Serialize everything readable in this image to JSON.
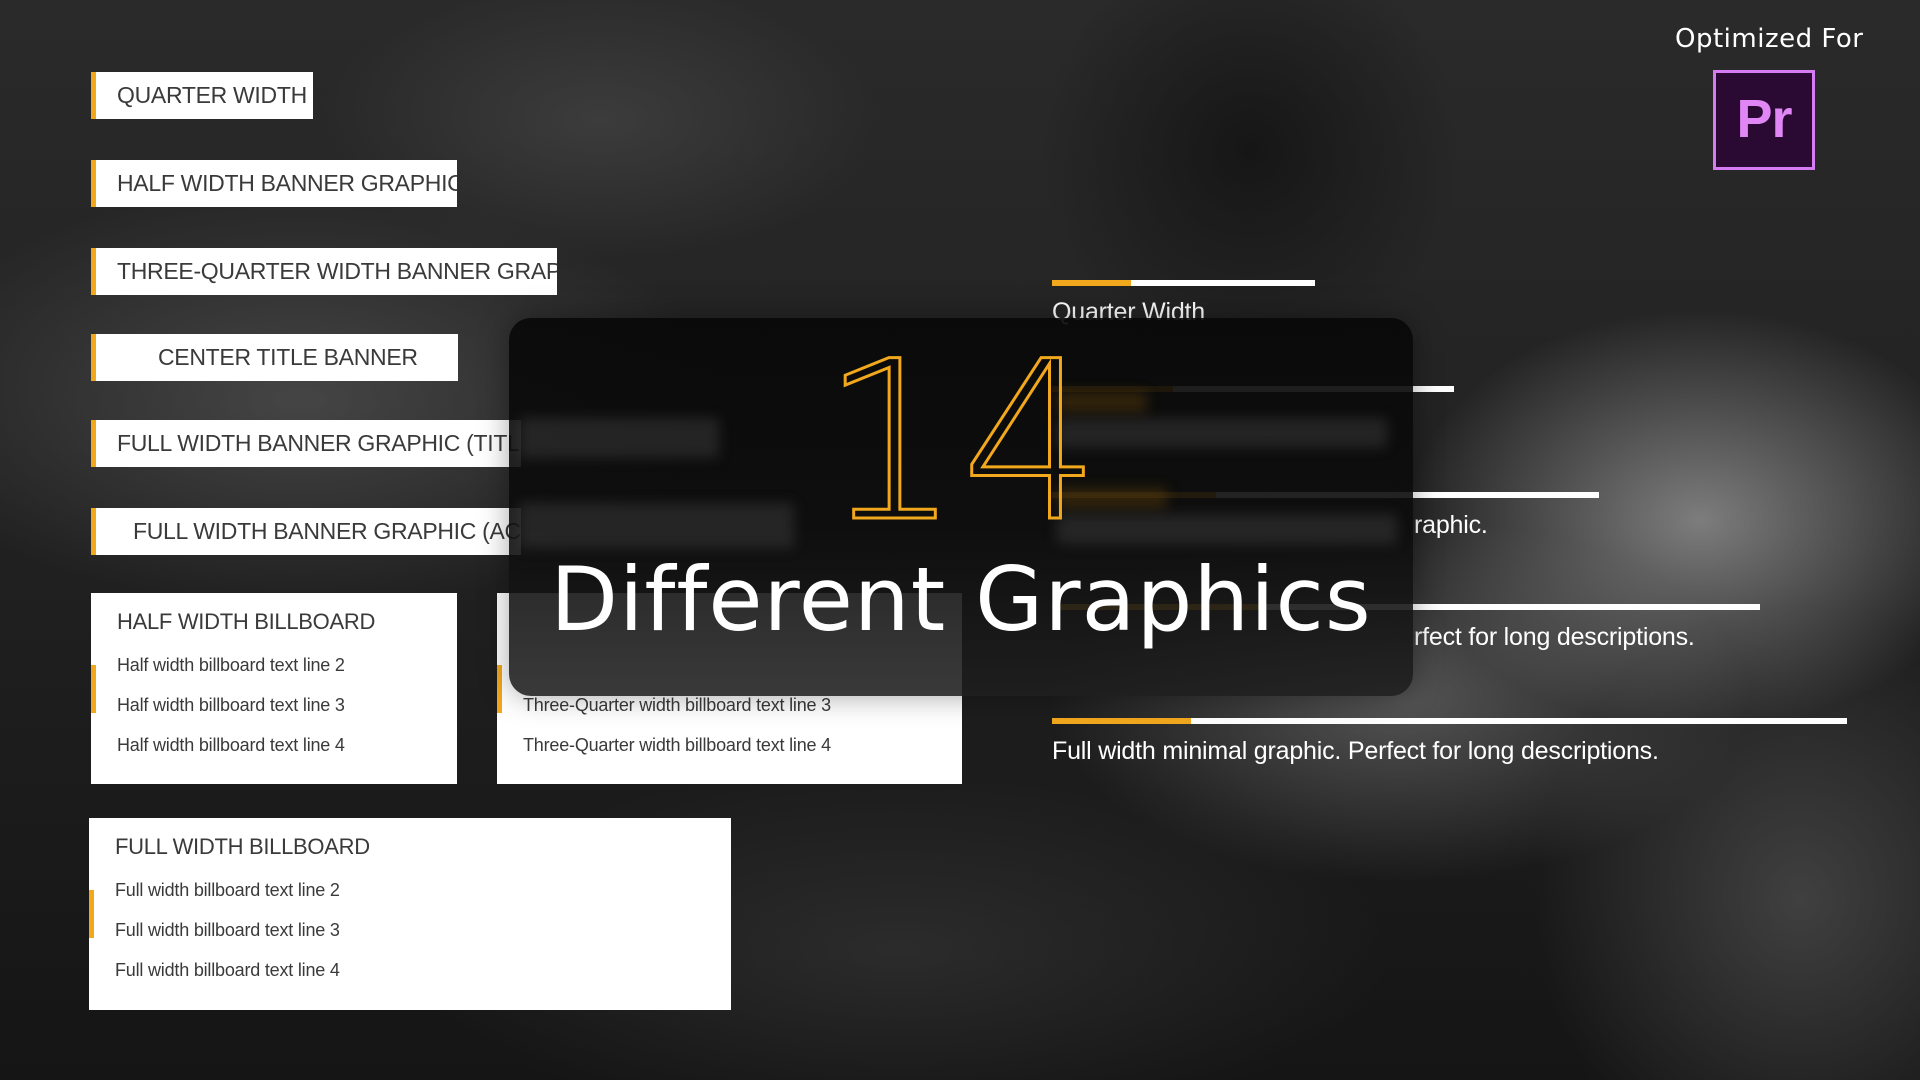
{
  "banners": [
    {
      "label": "QUARTER WIDTH"
    },
    {
      "label": "HALF WIDTH BANNER GRAPHIC"
    },
    {
      "label": "THREE-QUARTER WIDTH BANNER GRAPHIC"
    },
    {
      "label": "CENTER TITLE BANNER"
    },
    {
      "label": "FULL WIDTH BANNER GRAPHIC (TITLE S"
    },
    {
      "label": "FULL WIDTH BANNER GRAPHIC (ACTI"
    }
  ],
  "billboards": {
    "half": {
      "title": "HALF WIDTH BILLBOARD",
      "lines": [
        "Half width billboard text line 2",
        "Half width billboard text line 3",
        "Half width billboard text line 4"
      ]
    },
    "three_quarter": {
      "lines": [
        "Three-Quarter width billboard text line 3",
        "Three-Quarter width billboard text line 4"
      ]
    },
    "full": {
      "title": "FULL WIDTH BILLBOARD",
      "lines": [
        "Full width billboard text line 2",
        "Full width billboard text line 3",
        "Full width billboard text line 4"
      ]
    }
  },
  "minimal": [
    {
      "text": "Quarter Width",
      "accent_fraction": 0.3
    },
    {
      "text": "",
      "accent_fraction": 0.3
    },
    {
      "text": "raphic.",
      "accent_fraction": 0.3
    },
    {
      "text": "rfect for long descriptions.",
      "accent_fraction": 0.3
    },
    {
      "text": "Full width minimal graphic. Perfect for long descriptions.",
      "accent_fraction": 0.175
    }
  ],
  "promo": {
    "count": "14",
    "headline": "Different Graphics"
  },
  "optimized": {
    "label": "Optimized For",
    "app_logo_text": "Pr",
    "app_icon": "premiere-pro-icon"
  },
  "colors": {
    "accent": "#f2a81d",
    "premiere_border": "#d67cf2",
    "premiere_bg": "#2a0a33"
  }
}
